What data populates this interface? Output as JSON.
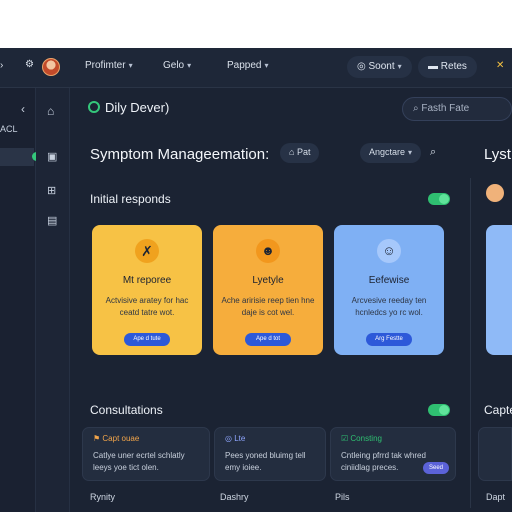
{
  "topbar": {
    "menu1": "Profimter",
    "menu2": "Gelo",
    "menu3": "Papped",
    "pill1": "Soont",
    "pill2": "Retes",
    "close": "✕"
  },
  "leftrail": {
    "partial_label": "ACL"
  },
  "header": {
    "brand": "Dily Dever)",
    "search_placeholder": "Fasth Fate",
    "title": "Symptom Manageemation:",
    "chip1": "Pat",
    "chip2": "Angctare",
    "side_title": "Lyst"
  },
  "section1": {
    "title": "Initial responds"
  },
  "cards": [
    {
      "title": "Mt reporee",
      "desc": "Actvisive aratey for hac ceatd tatre wot.",
      "button": "Ape d tute",
      "bg": "#f7c245",
      "icon_bg": "#f0a21e"
    },
    {
      "title": "Lyetyle",
      "desc": "Ache aririsie reep tien hne daje is cot wel.",
      "button": "Ape d tot",
      "bg": "#f6ad3c",
      "icon_bg": "#f2971d"
    },
    {
      "title": "Eefewise",
      "desc": "Arcvesive reeday ten hcnledcs yo rc wol.",
      "button": "Arg Festte",
      "bg": "#7fb0f4",
      "icon_bg": "#5c93e6"
    }
  ],
  "section2": {
    "title": "Consultations",
    "side_title": "Capte"
  },
  "consultations": [
    {
      "tag": "Capt ouae",
      "tag_color": "#f2a54a",
      "text": "Catlye uner ecrtel schlatly leeys yoe tict olen.",
      "button": ""
    },
    {
      "tag": "Lte",
      "tag_color": "#8fa6ff",
      "text": "Pees yoned bluimg tell emy ioiee.",
      "button": ""
    },
    {
      "tag": "Consting",
      "tag_color": "#2fbf71",
      "text": "Cntleing pfrrd tak whred ciniidlag preces.",
      "button": "Seed"
    }
  ],
  "footer": {
    "left": "Rynity",
    "mid": "Dashry",
    "right": "Pils",
    "far_right": "Dapt"
  },
  "colors": {
    "accent_green": "#34c77b",
    "bg": "#1b2333"
  }
}
